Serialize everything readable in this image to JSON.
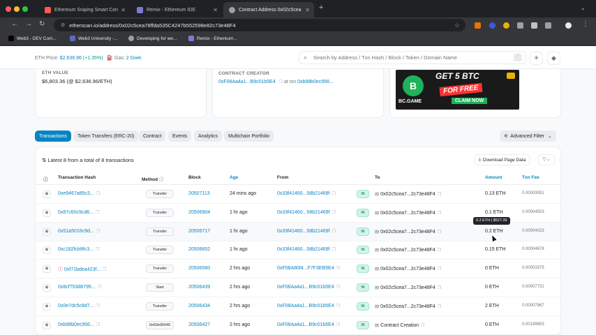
{
  "browser": {
    "tabs": [
      {
        "title": "Ethereum Sniping Smart Con",
        "favicon_color": "#ff5a4f"
      },
      {
        "title": "Remix - Ethereum IDE",
        "favicon_color": "#7b7bd6"
      },
      {
        "title": "Contract Address 0x02c5cea",
        "favicon_color": "#9aa0a6"
      }
    ],
    "url": "etherscan.io/address/0x02c5cea78ffda535C4247b552598e82c73e48F4",
    "bookmarks": [
      "Web3 - DEV Com...",
      "Web3 University -...",
      "Developing for we...",
      "Remix - Ethereum..."
    ]
  },
  "etherscan": {
    "eth_price_label": "ETH Price:",
    "eth_price": "$2,636.96",
    "eth_change": "(+1.35%)",
    "gas_label": "Gas:",
    "gas": "2 Gwei",
    "search_placeholder": "Search by Address / Txn Hash / Block / Token / Domain Name",
    "search_shortcut": "/"
  },
  "overview": {
    "eth_value_label": "ETH VALUE",
    "eth_value": "$6,803.36 (@ $2,636.96/ETH)",
    "creator_label": "CONTRACT CREATOR",
    "creator_address": "0xF08Aa4a1...B9c01b5E4",
    "creator_at": "at txn",
    "creator_txn": "0xb98b0ec956..."
  },
  "ad": {
    "headline": "GET 5 BTC",
    "tag": "FOR FREE",
    "cta": "CLAIM NOW",
    "brand": "BC.GAME",
    "logo_letter": "B"
  },
  "tabs": [
    {
      "label": "Transactions",
      "active": true
    },
    {
      "label": "Token Transfers (ERC-20)",
      "active": false
    },
    {
      "label": "Contract",
      "active": false
    },
    {
      "label": "Events",
      "active": false
    },
    {
      "label": "Analytics",
      "active": false
    },
    {
      "label": "Multichain Portfolio",
      "active": false
    }
  ],
  "advanced_filter": "Advanced Filter",
  "table": {
    "summary": "Latest 8 from a total of 8 transactions",
    "download": "Download Page Data",
    "columns": [
      "Transaction Hash",
      "Method",
      "Block",
      "Age",
      "From",
      "To",
      "Amount",
      "Txn Fee"
    ],
    "rows": [
      {
        "hash": "0xe9467a85c3...",
        "method": "Transfer",
        "block": "20507113",
        "age": "24 mins ago",
        "from": "0x33f41460...58b21469f",
        "to": "0x02c5cea7...2c73e48F4",
        "amount": "0.13 ETH",
        "fee": "0.00003051",
        "error": false
      },
      {
        "hash": "0x87c60c9cd6...",
        "method": "Transfer",
        "block": "20506904",
        "age": "1 hr ago",
        "from": "0x33f41460...58b21469f",
        "to": "0x02c5cea7...2c73e48F4",
        "amount": "0.1 ETH",
        "fee": "0.00004503",
        "error": false
      },
      {
        "hash": "0x51a5016c9d...",
        "method": "Transfer",
        "block": "20506717",
        "age": "1 hr ago",
        "from": "0x33f41460...58b21469f",
        "to": "0x02c5cea7...2c73e48F4",
        "amount": "0.2 ETH",
        "fee": "0.00004023",
        "error": false
      },
      {
        "hash": "0xc182fcb9fc3...",
        "method": "Transfer",
        "block": "20506652",
        "age": "1 hr ago",
        "from": "0x33f41460...58b21469f",
        "to": "0x02c5cea7...2c73e48F4",
        "amount": "0.15 ETH",
        "fee": "0.00004678",
        "error": false
      },
      {
        "hash": "0xf71bdea423f...",
        "method": "Transfer",
        "block": "20506560",
        "age": "2 hrs ago",
        "from": "0xF08A80f4...F7F3EB5E4",
        "to": "0x02c5cea7...2c73e48F4",
        "amount": "0 ETH",
        "fee": "0.00003375",
        "error": true
      },
      {
        "hash": "0x8cf753d8795...",
        "method": "Start",
        "block": "20506439",
        "age": "2 hrs ago",
        "from": "0xF08Aa4a1...B9c01b5E4",
        "to": "0x02c5cea7...2c73e48F4",
        "amount": "0 ETH",
        "fee": "0.00007731",
        "error": false
      },
      {
        "hash": "0x0e7dc5c8d7...",
        "method": "Transfer",
        "block": "20506434",
        "age": "2 hrs ago",
        "from": "0xF08Aa4a1...B9c01b5E4",
        "to": "0x02c5cea7...2c73e48F4",
        "amount": "2 ETH",
        "fee": "0.00007867",
        "error": false
      },
      {
        "hash": "0xb98b0ec956...",
        "method": "0x60e06040",
        "block": "20506427",
        "age": "2 hrs ago",
        "from": "0xF08Aa4a1...B9c01b5E4",
        "to": "Contract Creation",
        "amount": "0 ETH",
        "fee": "0.00199653",
        "error": false
      }
    ],
    "in_label": "IN",
    "tooltip": "0.2 ETH | $527.39"
  },
  "colors": {
    "accent": "#0784c3",
    "success": "#00a186",
    "error": "#dc3545"
  }
}
